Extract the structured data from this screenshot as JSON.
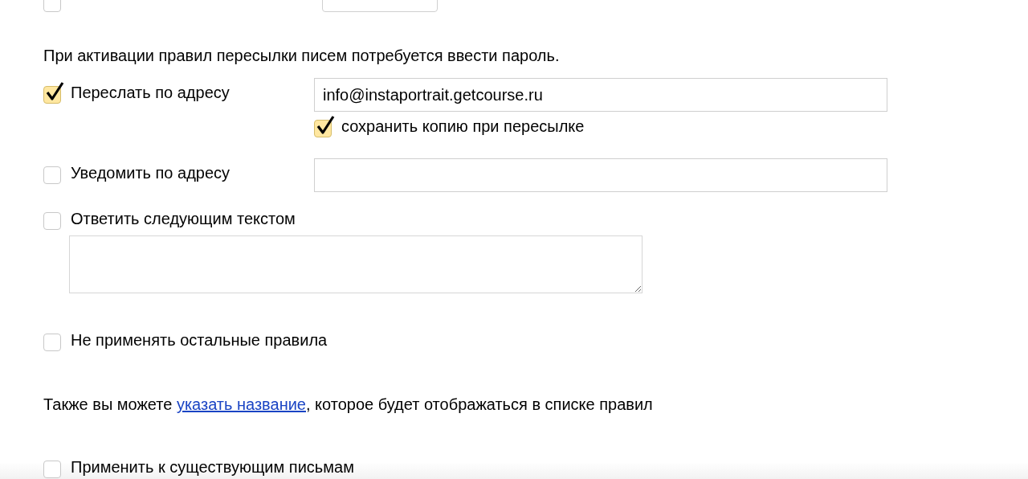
{
  "top_row": {
    "checkbox": {
      "checked": false
    }
  },
  "notice": "При активации правил пересылки писем потребуется ввести пароль.",
  "forward": {
    "label": "Переслать по адресу",
    "checked": true,
    "value": "info@instaportrait.getcourse.ru",
    "keep_copy": {
      "label": "сохранить копию при пересылке",
      "checked": true
    }
  },
  "notify": {
    "label": "Уведомить по адресу",
    "checked": false
  },
  "reply": {
    "label": "Ответить следующим текстом",
    "checked": false
  },
  "stop": {
    "label": "Не применять остальные правила",
    "checked": false
  },
  "name_hint": {
    "before": "Также вы можете ",
    "link": "указать название",
    "after": ", которое будет отображаться в списке правил"
  },
  "apply_existing": {
    "label": "Применить к существующим письмам",
    "checked": false
  }
}
